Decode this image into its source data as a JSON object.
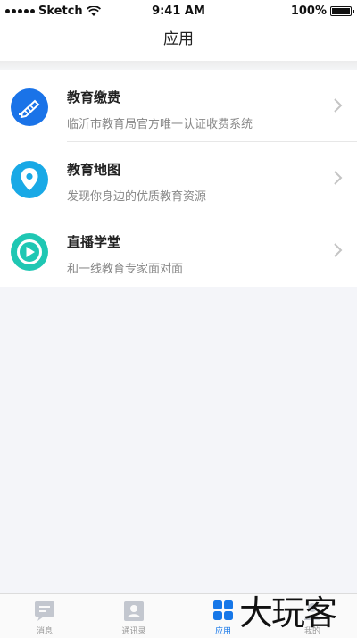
{
  "status_bar": {
    "carrier": "Sketch",
    "time": "9:41 AM",
    "battery": "100%"
  },
  "nav": {
    "title": "应用"
  },
  "apps": [
    {
      "title": "教育缴费",
      "subtitle": "临沂市教育局官方唯一认证收费系统",
      "icon": "pen-icon",
      "color": "#1a73e8"
    },
    {
      "title": "教育地图",
      "subtitle": "发现你身边的优质教育资源",
      "icon": "map-pin-icon",
      "color": "#19a9e6"
    },
    {
      "title": "直播学堂",
      "subtitle": "和一线教育专家面对面",
      "icon": "play-icon",
      "color": "#1fc7b3"
    }
  ],
  "tabs": [
    {
      "label": "消息",
      "icon": "message-icon"
    },
    {
      "label": "通讯录",
      "icon": "contacts-icon"
    },
    {
      "label": "应用",
      "icon": "apps-icon"
    },
    {
      "label": "我的",
      "icon": "profile-icon"
    }
  ],
  "watermark": "大玩客",
  "colors": {
    "accent": "#1677e8",
    "background": "#f4f5f9"
  }
}
